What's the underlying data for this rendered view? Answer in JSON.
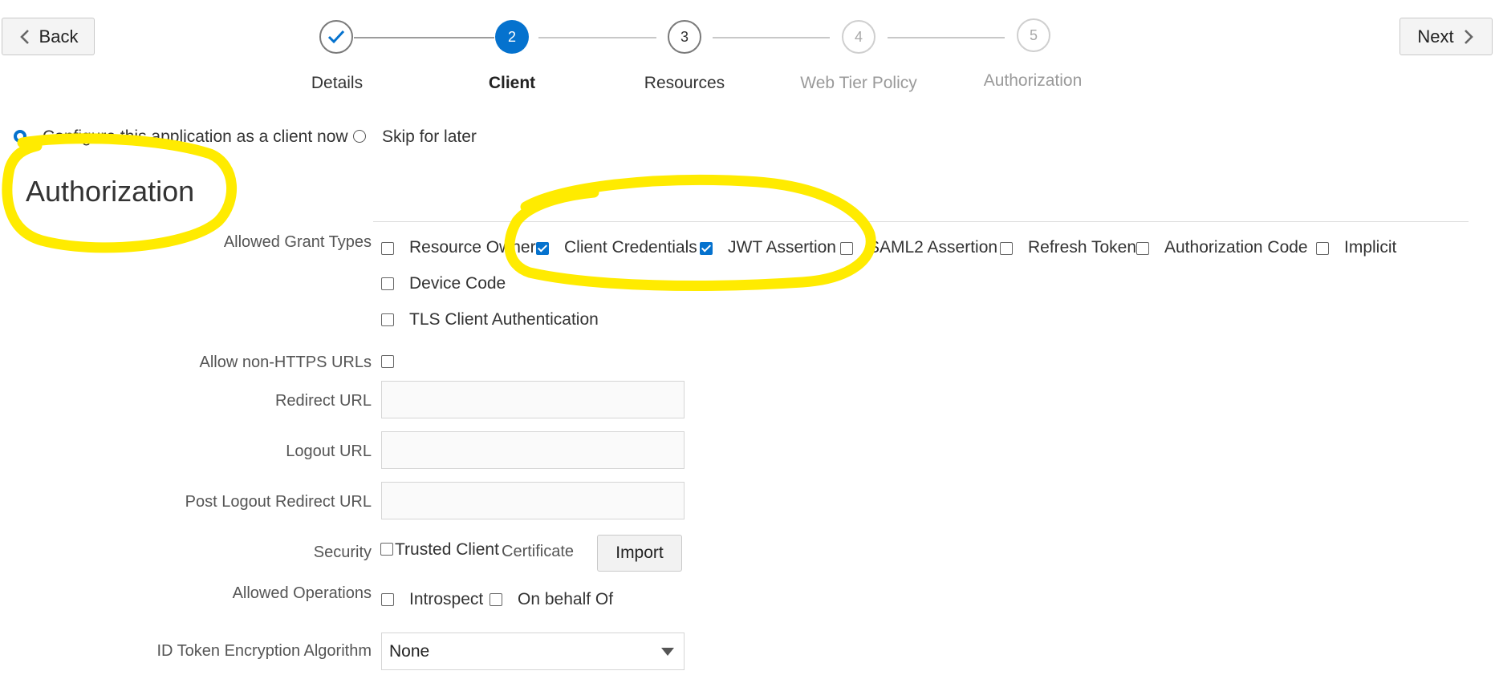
{
  "nav": {
    "back_label": "Back",
    "next_label": "Next"
  },
  "steps": [
    {
      "number": "",
      "label": "Details",
      "state": "complete"
    },
    {
      "number": "2",
      "label": "Client",
      "state": "current"
    },
    {
      "number": "3",
      "label": "Resources",
      "state": "enabled"
    },
    {
      "number": "4",
      "label": "Web Tier Policy",
      "state": "disabled"
    },
    {
      "number": "5",
      "label": "Authorization",
      "state": "disabled"
    }
  ],
  "client_config": {
    "configure_now_label": "Configure this application as a client now",
    "skip_label": "Skip for later",
    "selected": "configure_now"
  },
  "section": {
    "title": "Authorization"
  },
  "form": {
    "grant_types_label": "Allowed Grant Types",
    "grant_types": [
      {
        "label": "Resource Owner",
        "checked": false
      },
      {
        "label": "Client Credentials",
        "checked": true
      },
      {
        "label": "JWT Assertion",
        "checked": true
      },
      {
        "label": "SAML2 Assertion",
        "checked": false
      },
      {
        "label": "Refresh Token",
        "checked": false
      },
      {
        "label": "Authorization Code",
        "checked": false
      },
      {
        "label": "Implicit",
        "checked": false
      },
      {
        "label": "Device Code",
        "checked": false
      },
      {
        "label": "TLS Client Authentication",
        "checked": false
      }
    ],
    "allow_non_https_label": "Allow non-HTTPS URLs",
    "allow_non_https_checked": false,
    "redirect_url_label": "Redirect URL",
    "redirect_url_value": "",
    "logout_url_label": "Logout URL",
    "logout_url_value": "",
    "post_logout_label": "Post Logout Redirect URL",
    "post_logout_value": "",
    "security_label": "Security",
    "trusted_client_label": "Trusted Client",
    "certificate_label": "Certificate",
    "trusted_client_checked": false,
    "import_label": "Import",
    "allowed_operations_label": "Allowed Operations",
    "operations": [
      {
        "label": "Introspect",
        "checked": false
      },
      {
        "label": "On behalf Of",
        "checked": false
      }
    ],
    "id_token_label": "ID Token Encryption Algorithm",
    "id_token_value": "None"
  },
  "colors": {
    "accent": "#0572ce",
    "highlight": "#ffeb00",
    "disabled_text": "#9a9a9a"
  }
}
